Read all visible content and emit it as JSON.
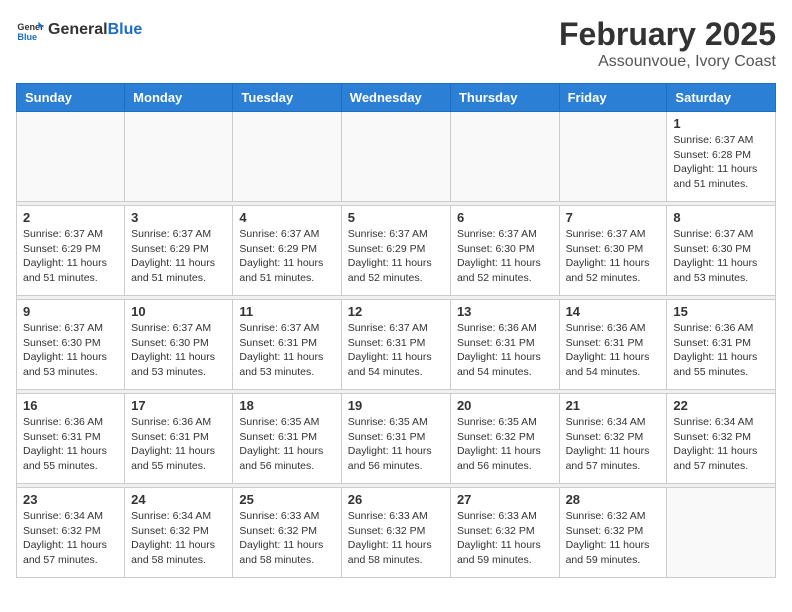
{
  "header": {
    "logo_general": "General",
    "logo_blue": "Blue",
    "month": "February 2025",
    "location": "Assounvoue, Ivory Coast"
  },
  "weekdays": [
    "Sunday",
    "Monday",
    "Tuesday",
    "Wednesday",
    "Thursday",
    "Friday",
    "Saturday"
  ],
  "weeks": [
    [
      {
        "day": "",
        "info": ""
      },
      {
        "day": "",
        "info": ""
      },
      {
        "day": "",
        "info": ""
      },
      {
        "day": "",
        "info": ""
      },
      {
        "day": "",
        "info": ""
      },
      {
        "day": "",
        "info": ""
      },
      {
        "day": "1",
        "info": "Sunrise: 6:37 AM\nSunset: 6:28 PM\nDaylight: 11 hours\nand 51 minutes."
      }
    ],
    [
      {
        "day": "2",
        "info": "Sunrise: 6:37 AM\nSunset: 6:29 PM\nDaylight: 11 hours\nand 51 minutes."
      },
      {
        "day": "3",
        "info": "Sunrise: 6:37 AM\nSunset: 6:29 PM\nDaylight: 11 hours\nand 51 minutes."
      },
      {
        "day": "4",
        "info": "Sunrise: 6:37 AM\nSunset: 6:29 PM\nDaylight: 11 hours\nand 51 minutes."
      },
      {
        "day": "5",
        "info": "Sunrise: 6:37 AM\nSunset: 6:29 PM\nDaylight: 11 hours\nand 52 minutes."
      },
      {
        "day": "6",
        "info": "Sunrise: 6:37 AM\nSunset: 6:30 PM\nDaylight: 11 hours\nand 52 minutes."
      },
      {
        "day": "7",
        "info": "Sunrise: 6:37 AM\nSunset: 6:30 PM\nDaylight: 11 hours\nand 52 minutes."
      },
      {
        "day": "8",
        "info": "Sunrise: 6:37 AM\nSunset: 6:30 PM\nDaylight: 11 hours\nand 53 minutes."
      }
    ],
    [
      {
        "day": "9",
        "info": "Sunrise: 6:37 AM\nSunset: 6:30 PM\nDaylight: 11 hours\nand 53 minutes."
      },
      {
        "day": "10",
        "info": "Sunrise: 6:37 AM\nSunset: 6:30 PM\nDaylight: 11 hours\nand 53 minutes."
      },
      {
        "day": "11",
        "info": "Sunrise: 6:37 AM\nSunset: 6:31 PM\nDaylight: 11 hours\nand 53 minutes."
      },
      {
        "day": "12",
        "info": "Sunrise: 6:37 AM\nSunset: 6:31 PM\nDaylight: 11 hours\nand 54 minutes."
      },
      {
        "day": "13",
        "info": "Sunrise: 6:36 AM\nSunset: 6:31 PM\nDaylight: 11 hours\nand 54 minutes."
      },
      {
        "day": "14",
        "info": "Sunrise: 6:36 AM\nSunset: 6:31 PM\nDaylight: 11 hours\nand 54 minutes."
      },
      {
        "day": "15",
        "info": "Sunrise: 6:36 AM\nSunset: 6:31 PM\nDaylight: 11 hours\nand 55 minutes."
      }
    ],
    [
      {
        "day": "16",
        "info": "Sunrise: 6:36 AM\nSunset: 6:31 PM\nDaylight: 11 hours\nand 55 minutes."
      },
      {
        "day": "17",
        "info": "Sunrise: 6:36 AM\nSunset: 6:31 PM\nDaylight: 11 hours\nand 55 minutes."
      },
      {
        "day": "18",
        "info": "Sunrise: 6:35 AM\nSunset: 6:31 PM\nDaylight: 11 hours\nand 56 minutes."
      },
      {
        "day": "19",
        "info": "Sunrise: 6:35 AM\nSunset: 6:31 PM\nDaylight: 11 hours\nand 56 minutes."
      },
      {
        "day": "20",
        "info": "Sunrise: 6:35 AM\nSunset: 6:32 PM\nDaylight: 11 hours\nand 56 minutes."
      },
      {
        "day": "21",
        "info": "Sunrise: 6:34 AM\nSunset: 6:32 PM\nDaylight: 11 hours\nand 57 minutes."
      },
      {
        "day": "22",
        "info": "Sunrise: 6:34 AM\nSunset: 6:32 PM\nDaylight: 11 hours\nand 57 minutes."
      }
    ],
    [
      {
        "day": "23",
        "info": "Sunrise: 6:34 AM\nSunset: 6:32 PM\nDaylight: 11 hours\nand 57 minutes."
      },
      {
        "day": "24",
        "info": "Sunrise: 6:34 AM\nSunset: 6:32 PM\nDaylight: 11 hours\nand 58 minutes."
      },
      {
        "day": "25",
        "info": "Sunrise: 6:33 AM\nSunset: 6:32 PM\nDaylight: 11 hours\nand 58 minutes."
      },
      {
        "day": "26",
        "info": "Sunrise: 6:33 AM\nSunset: 6:32 PM\nDaylight: 11 hours\nand 58 minutes."
      },
      {
        "day": "27",
        "info": "Sunrise: 6:33 AM\nSunset: 6:32 PM\nDaylight: 11 hours\nand 59 minutes."
      },
      {
        "day": "28",
        "info": "Sunrise: 6:32 AM\nSunset: 6:32 PM\nDaylight: 11 hours\nand 59 minutes."
      },
      {
        "day": "",
        "info": ""
      }
    ]
  ]
}
